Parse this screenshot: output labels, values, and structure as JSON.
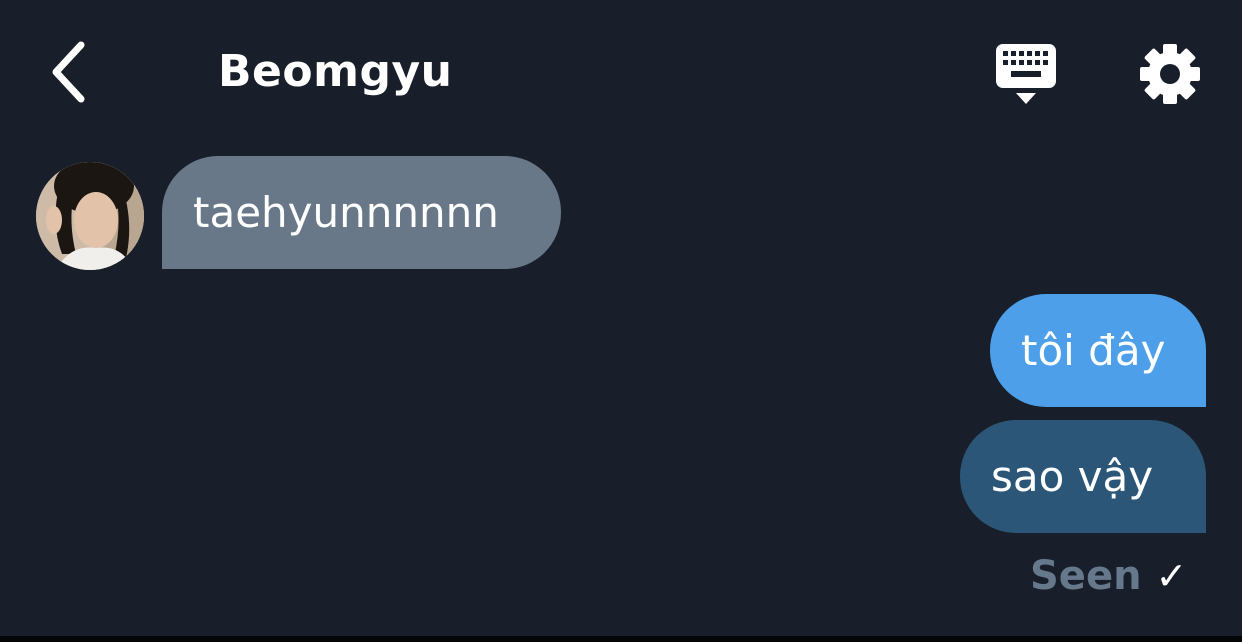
{
  "header": {
    "title": "Beomgyu",
    "back_icon": "chevron-left-icon",
    "keyboard_icon": "keyboard-icon",
    "settings_icon": "gear-icon"
  },
  "contact": {
    "avatar_icon": "avatar-photo"
  },
  "messages": [
    {
      "direction": "incoming",
      "text": "taehyunnnnnn"
    },
    {
      "direction": "outgoing",
      "text": "tôi đây"
    },
    {
      "direction": "outgoing",
      "text": "sao vậy"
    }
  ],
  "status": {
    "label": "Seen",
    "check": "✓"
  },
  "colors": {
    "background": "#181f2a",
    "incoming_bubble": "#687888",
    "outgoing_bubble_light": "#4d9fe9",
    "outgoing_bubble_dark": "#2b5678",
    "seen_text": "#66788b"
  }
}
